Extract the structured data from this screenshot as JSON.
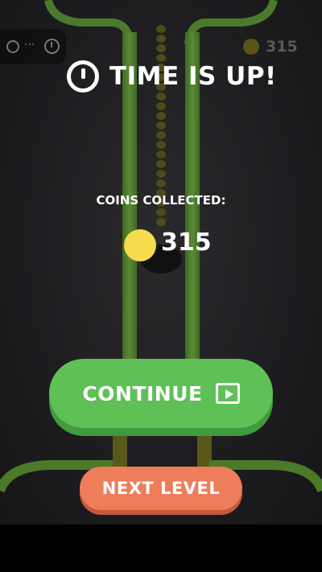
{
  "hud": {
    "lives_dots": "...",
    "score": "315"
  },
  "dialog": {
    "title": "TIME IS UP!",
    "coins_label": "COINS COLLECTED:",
    "coins_value": "315"
  },
  "buttons": {
    "continue_label": "CONTINUE",
    "continue_icon": "video-ad-icon",
    "next_level_label": "NEXT LEVEL"
  },
  "colors": {
    "track_green": "#4a7a2a",
    "continue_green": "#5ec056",
    "next_orange": "#ed7d5b",
    "coin_yellow": "#f6dc4d"
  }
}
